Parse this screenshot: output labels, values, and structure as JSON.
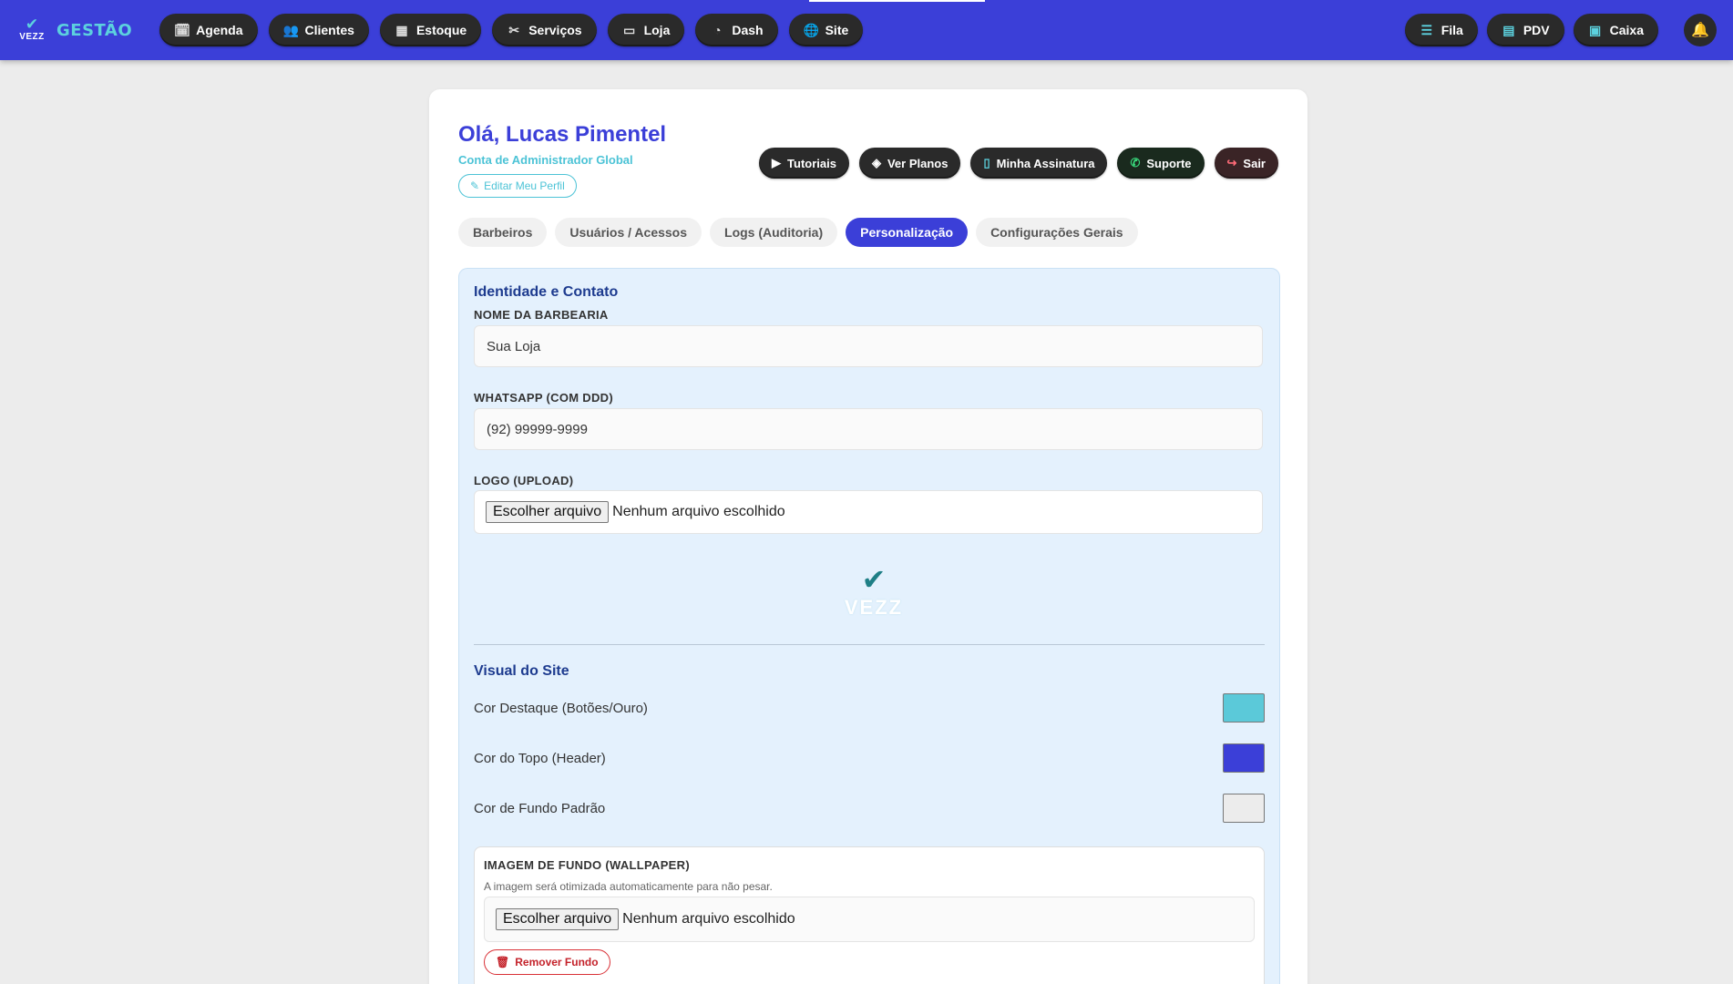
{
  "brand": {
    "logo_mark": "✔",
    "logo_word": "VEZZ",
    "name": "GESTÃO"
  },
  "nav": {
    "left": [
      {
        "label": "Agenda",
        "icon": "calendar-icon",
        "glyph": "🗓"
      },
      {
        "label": "Clientes",
        "icon": "users-icon",
        "glyph": "👥"
      },
      {
        "label": "Estoque",
        "icon": "boxes-icon",
        "glyph": "▦"
      },
      {
        "label": "Serviços",
        "icon": "scissors-icon",
        "glyph": "✂"
      },
      {
        "label": "Loja",
        "icon": "store-icon",
        "glyph": "▭"
      },
      {
        "label": "Dash",
        "icon": "pie-chart-icon",
        "glyph": "◔"
      },
      {
        "label": "Site",
        "icon": "globe-icon",
        "glyph": "🌐"
      }
    ],
    "right": [
      {
        "label": "Fila",
        "icon": "list-icon",
        "glyph": "☰"
      },
      {
        "label": "PDV",
        "icon": "cash-register-icon",
        "glyph": "▤"
      },
      {
        "label": "Caixa",
        "icon": "money-icon",
        "glyph": "▣"
      }
    ],
    "bell_glyph": "🔔"
  },
  "profile": {
    "greeting": "Olá, Lucas Pimentel",
    "role": "Conta de Administrador Global",
    "edit_label": "Editar Meu Perfil",
    "edit_glyph": "✎"
  },
  "actions": [
    {
      "label": "Tutoriais",
      "icon": "youtube-icon",
      "glyph": "▶"
    },
    {
      "label": "Ver Planos",
      "icon": "layers-icon",
      "glyph": "◈"
    },
    {
      "label": "Minha Assinatura",
      "icon": "document-icon",
      "glyph": "▯"
    },
    {
      "label": "Suporte",
      "icon": "whatsapp-icon",
      "glyph": "✆"
    },
    {
      "label": "Sair",
      "icon": "logout-icon",
      "glyph": "↪"
    }
  ],
  "tabs": [
    {
      "label": "Barbeiros",
      "active": false
    },
    {
      "label": "Usuários / Acessos",
      "active": false
    },
    {
      "label": "Logs (Auditoria)",
      "active": false
    },
    {
      "label": "Personalização",
      "active": true
    },
    {
      "label": "Configurações Gerais",
      "active": false
    }
  ],
  "identity": {
    "title": "Identidade e Contato",
    "name_label": "NOME DA BARBEARIA",
    "name_value": "Sua Loja",
    "whatsapp_label": "WHATSAPP (COM DDD)",
    "whatsapp_value": "(92) 99999-9999",
    "logo_label": "LOGO (UPLOAD)",
    "file_button": "Escolher arquivo",
    "file_status": "Nenhum arquivo escolhido",
    "preview_mark": "✔",
    "preview_word": "VEZZ"
  },
  "visual": {
    "title": "Visual do Site",
    "colors": [
      {
        "label": "Cor Destaque (Botões/Ouro)",
        "value": "#5bc9d9"
      },
      {
        "label": "Cor do Topo (Header)",
        "value": "#3b3fd8"
      },
      {
        "label": "Cor de Fundo Padrão",
        "value": "#ececec"
      }
    ],
    "wallpaper": {
      "label": "IMAGEM DE FUNDO (WALLPAPER)",
      "hint": "A imagem será otimizada automaticamente para não pesar.",
      "file_button": "Escolher arquivo",
      "file_status": "Nenhum arquivo escolhido",
      "remove_label": "Remover Fundo",
      "remove_glyph": "🗑"
    }
  }
}
